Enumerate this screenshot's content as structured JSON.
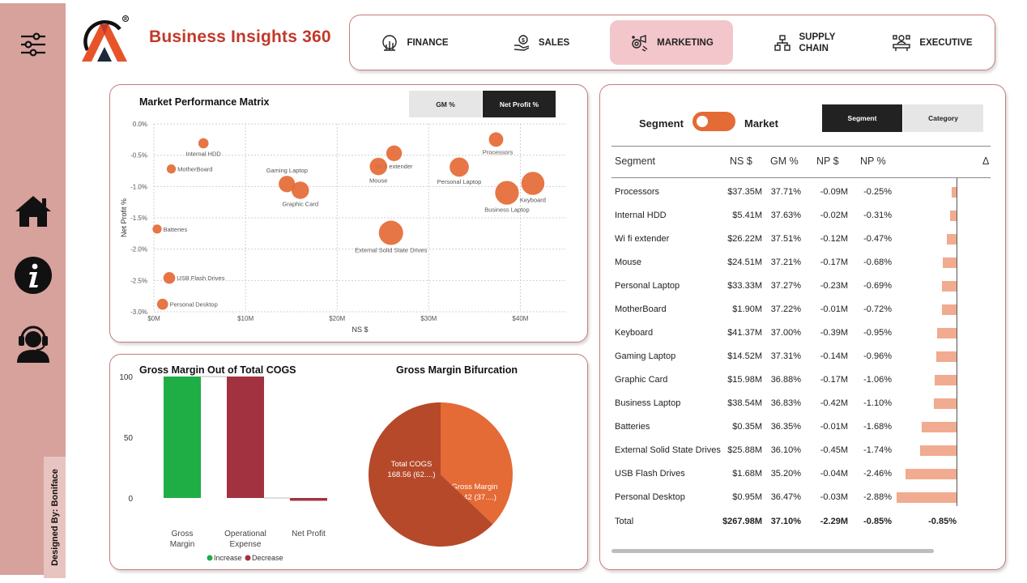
{
  "app": {
    "title": "Business Insights 360",
    "designer": "Designed By: Boniface"
  },
  "colors": {
    "accent": "#e46a36",
    "brand_red": "#c0392b",
    "sidebar": "#d7a19c",
    "active_tab": "#f2c6cb",
    "increase": "#1fae45",
    "decrease": "#a33240",
    "delta_bar": "#f1ab90"
  },
  "nav": {
    "tabs": [
      {
        "label": "FINANCE",
        "icon": "finance-icon",
        "active": false
      },
      {
        "label": "SALES",
        "icon": "sales-icon",
        "active": false
      },
      {
        "label": "MARKETING",
        "icon": "marketing-icon",
        "active": true
      },
      {
        "label": "SUPPLY\nCHAIN",
        "icon": "supply-chain-icon",
        "active": false
      },
      {
        "label": "EXECUTIVE",
        "icon": "executive-icon",
        "active": false
      }
    ]
  },
  "sidebar": {
    "icons": [
      "filter-icon",
      "home-icon",
      "info-icon",
      "support-agent-icon"
    ]
  },
  "matrix": {
    "title": "Market Performance Matrix",
    "toggles": [
      {
        "label": "GM %",
        "active": false
      },
      {
        "label": "Net Profit %",
        "active": true
      }
    ]
  },
  "waterfall": {
    "title": "Gross Margin Out of Total COGS",
    "legend_increase": "Increase",
    "legend_decrease": "Decrease"
  },
  "pie": {
    "title": "Gross Margin Bifurcation"
  },
  "segment_panel": {
    "left_label": "Segment",
    "right_label": "Market",
    "buttons": [
      {
        "label": "Segment",
        "active": true
      },
      {
        "label": "Category",
        "active": false
      }
    ],
    "columns": [
      "Segment",
      "NS $",
      "GM %",
      "NP $",
      "NP %",
      "Δ"
    ],
    "rows": [
      {
        "name": "Processors",
        "ns": "$37.35M",
        "gm": "37.71%",
        "np": "-0.09M",
        "npp": "-0.25%",
        "delta": -0.25
      },
      {
        "name": "Internal HDD",
        "ns": "$5.41M",
        "gm": "37.63%",
        "np": "-0.02M",
        "npp": "-0.31%",
        "delta": -0.31
      },
      {
        "name": "Wi fi extender",
        "ns": "$26.22M",
        "gm": "37.51%",
        "np": "-0.12M",
        "npp": "-0.47%",
        "delta": -0.47
      },
      {
        "name": "Mouse",
        "ns": "$24.51M",
        "gm": "37.21%",
        "np": "-0.17M",
        "npp": "-0.68%",
        "delta": -0.68
      },
      {
        "name": "Personal Laptop",
        "ns": "$33.33M",
        "gm": "37.27%",
        "np": "-0.23M",
        "npp": "-0.69%",
        "delta": -0.69
      },
      {
        "name": "MotherBoard",
        "ns": "$1.90M",
        "gm": "37.22%",
        "np": "-0.01M",
        "npp": "-0.72%",
        "delta": -0.72
      },
      {
        "name": "Keyboard",
        "ns": "$41.37M",
        "gm": "37.00%",
        "np": "-0.39M",
        "npp": "-0.95%",
        "delta": -0.95
      },
      {
        "name": "Gaming Laptop",
        "ns": "$14.52M",
        "gm": "37.31%",
        "np": "-0.14M",
        "npp": "-0.96%",
        "delta": -0.96
      },
      {
        "name": "Graphic Card",
        "ns": "$15.98M",
        "gm": "36.88%",
        "np": "-0.17M",
        "npp": "-1.06%",
        "delta": -1.06
      },
      {
        "name": "Business Laptop",
        "ns": "$38.54M",
        "gm": "36.83%",
        "np": "-0.42M",
        "npp": "-1.10%",
        "delta": -1.1
      },
      {
        "name": "Batteries",
        "ns": "$0.35M",
        "gm": "36.35%",
        "np": "-0.01M",
        "npp": "-1.68%",
        "delta": -1.68
      },
      {
        "name": "External Solid State Drives",
        "ns": "$25.88M",
        "gm": "36.10%",
        "np": "-0.45M",
        "npp": "-1.74%",
        "delta": -1.74
      },
      {
        "name": "USB Flash Drives",
        "ns": "$1.68M",
        "gm": "35.20%",
        "np": "-0.04M",
        "npp": "-2.46%",
        "delta": -2.46
      },
      {
        "name": "Personal Desktop",
        "ns": "$0.95M",
        "gm": "36.47%",
        "np": "-0.03M",
        "npp": "-2.88%",
        "delta": -2.88
      }
    ],
    "total": {
      "name": "Total",
      "ns": "$267.98M",
      "gm": "37.10%",
      "np": "-2.29M",
      "npp": "-0.85%",
      "delta_text": "-0.85%"
    }
  },
  "chart_data": [
    {
      "type": "scatter",
      "title": "Market Performance Matrix",
      "xlabel": "NS $",
      "ylabel": "Net Profit %",
      "xlim": [
        0,
        45
      ],
      "ylim": [
        -3.0,
        0.0
      ],
      "x_ticks": [
        0,
        10,
        20,
        30,
        40
      ],
      "x_tick_labels": [
        "$0M",
        "$10M",
        "$20M",
        "$30M",
        "$40M"
      ],
      "y_ticks": [
        0.0,
        -0.5,
        -1.0,
        -1.5,
        -2.0,
        -2.5,
        -3.0
      ],
      "y_tick_labels": [
        "0.0%",
        "-0.5%",
        "-1.0%",
        "-1.5%",
        "-2.0%",
        "-2.5%",
        "-3.0%"
      ],
      "grid": true,
      "points": [
        {
          "label": "Processors",
          "x": 37.35,
          "y": -0.25,
          "np": 0.09
        },
        {
          "label": "Internal HDD",
          "x": 5.41,
          "y": -0.31,
          "np": 0.02
        },
        {
          "label": "Wi fi extender",
          "x": 26.22,
          "y": -0.47,
          "np": 0.12
        },
        {
          "label": "Mouse",
          "x": 24.51,
          "y": -0.68,
          "np": 0.17
        },
        {
          "label": "Personal Laptop",
          "x": 33.33,
          "y": -0.69,
          "np": 0.23
        },
        {
          "label": "MotherBoard",
          "x": 1.9,
          "y": -0.72,
          "np": 0.01
        },
        {
          "label": "Keyboard",
          "x": 41.37,
          "y": -0.95,
          "np": 0.39
        },
        {
          "label": "Gaming Laptop",
          "x": 14.52,
          "y": -0.96,
          "np": 0.14
        },
        {
          "label": "Graphic Card",
          "x": 15.98,
          "y": -1.06,
          "np": 0.17
        },
        {
          "label": "Business Laptop",
          "x": 38.54,
          "y": -1.1,
          "np": 0.42
        },
        {
          "label": "Batteries",
          "x": 0.35,
          "y": -1.68,
          "np": 0.01
        },
        {
          "label": "External Solid State Drives",
          "x": 25.88,
          "y": -1.74,
          "np": 0.45
        },
        {
          "label": "USB Flash Drives",
          "x": 1.68,
          "y": -2.46,
          "np": 0.04
        },
        {
          "label": "Personal Desktop",
          "x": 0.95,
          "y": -2.88,
          "np": 0.03
        }
      ]
    },
    {
      "type": "bar",
      "subtype": "waterfall",
      "title": "Gross Margin Out of Total COGS",
      "categories": [
        "Gross\nMargin",
        "Operational\nExpense",
        "Net Profit"
      ],
      "values": [
        100,
        -100,
        -2.3
      ],
      "kind": [
        "increase",
        "decrease",
        "decrease"
      ],
      "ylim": [
        -10,
        100
      ],
      "y_ticks": [
        0,
        50,
        100
      ],
      "legend": [
        "Increase",
        "Decrease"
      ],
      "legend_position": "bottom"
    },
    {
      "type": "pie",
      "title": "Gross Margin Bifurcation",
      "slices": [
        {
          "label": "Gross Margin",
          "value": 99.42,
          "value_text": "99.42 (37....)",
          "color": "#e46a36"
        },
        {
          "label": "Total COGS",
          "value": 168.56,
          "value_text": "168.56 (62....)",
          "color": "#b5492a"
        }
      ]
    }
  ]
}
